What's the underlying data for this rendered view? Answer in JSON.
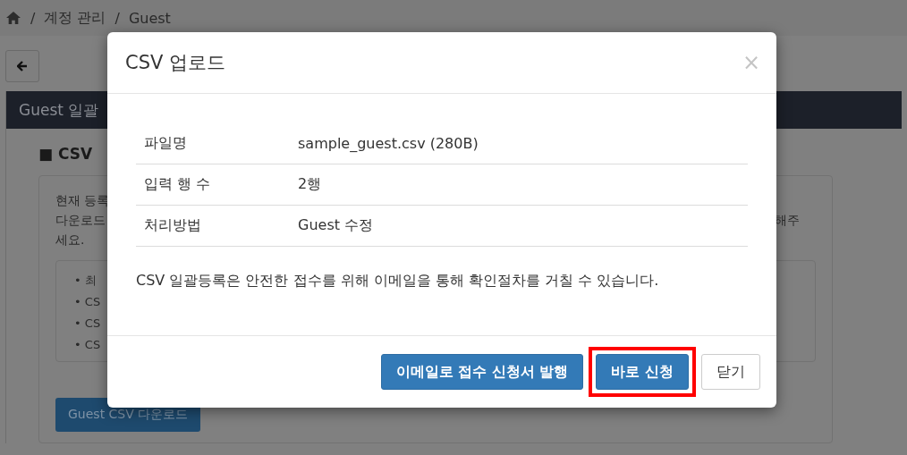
{
  "breadcrumb": {
    "separator": "/",
    "items": [
      "계정 관리",
      "Guest"
    ]
  },
  "panel_title": "Guest 일괄",
  "section_title": "■ CSV",
  "description": {
    "lines": [
      "현재 등록",
      "다운로드",
      "세요."
    ],
    "right_fragment": "해주"
  },
  "notes": [
    "• 최",
    "• CS",
    "• CS",
    "• CS"
  ],
  "download_button": "Guest CSV 다운로드",
  "modal": {
    "title": "CSV 업로드",
    "close": "×",
    "rows": [
      {
        "label": "파일명",
        "value": "sample_guest.csv (280B)"
      },
      {
        "label": "입력 행 수",
        "value": "2행"
      },
      {
        "label": "처리방법",
        "value": "Guest 수정"
      }
    ],
    "notice": "CSV 일괄등록은 안전한 접수를 위해 이메일을 통해 확인절차를 거칠 수 있습니다.",
    "buttons": [
      {
        "label": "이메일로 접수 신청서 발행",
        "kind": "primary",
        "highlighted": false
      },
      {
        "label": "바로 신청",
        "kind": "primary",
        "highlighted": true
      },
      {
        "label": "닫기",
        "kind": "default",
        "highlighted": false
      }
    ]
  }
}
